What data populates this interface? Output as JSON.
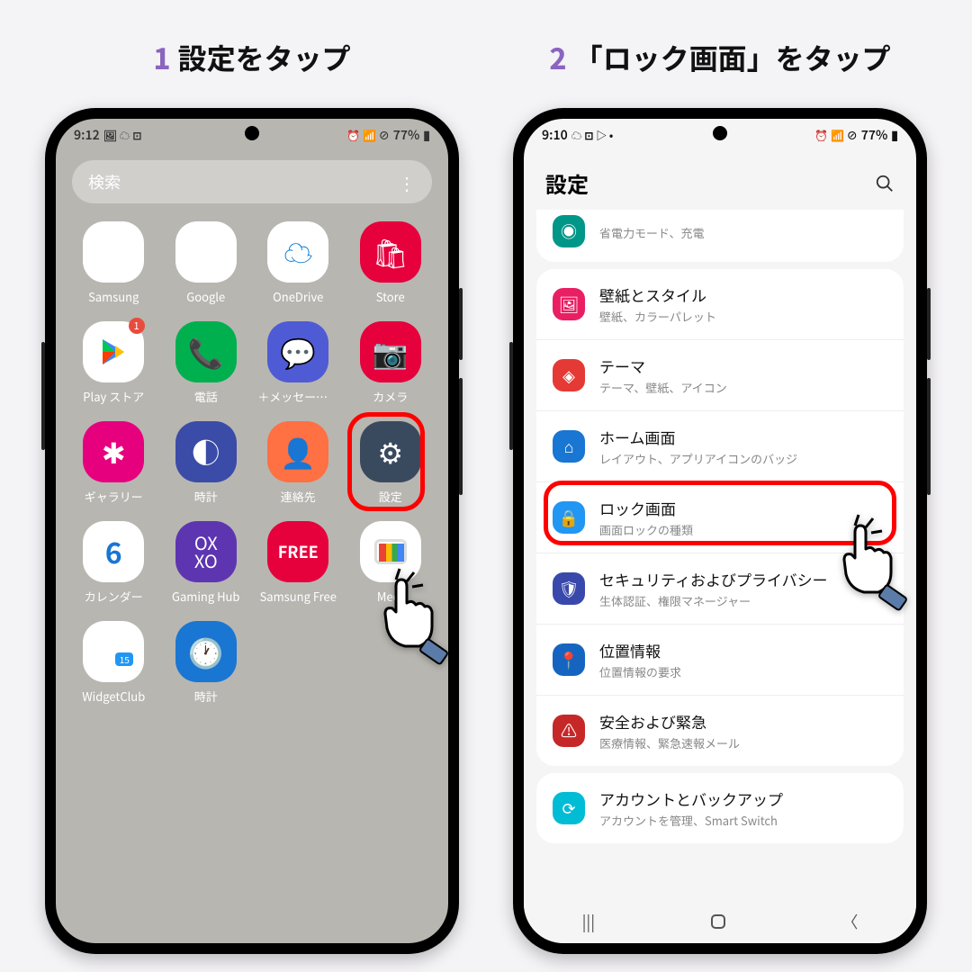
{
  "step1": {
    "num": "1",
    "text": "設定をタップ"
  },
  "step2": {
    "num": "2",
    "text": "「ロック画面」をタップ"
  },
  "status1": {
    "time": "9:12",
    "battery": "77%"
  },
  "status2": {
    "time": "9:10",
    "battery": "77%"
  },
  "search_placeholder": "検索",
  "apps": {
    "samsung": "Samsung",
    "google": "Google",
    "onedrive": "OneDrive",
    "store": "Store",
    "play": "Play ストア",
    "phone": "電話",
    "msg": "＋メッセージ(...",
    "camera": "カメラ",
    "gallery": "ギャラリー",
    "clock": "時計",
    "contacts": "連絡先",
    "settings": "設定",
    "calendar": "カレンダー",
    "gaming": "Gaming Hub",
    "free": "Samsung Free",
    "meet": "Meet",
    "widget": "WidgetClub",
    "clock2": "時計"
  },
  "play_badge": "1",
  "cal_num": "6",
  "free_label": "FREE",
  "gaming_label": "OX\nXO",
  "settings_title": "設定",
  "items": {
    "battery_sub": "省電力モード、充電",
    "wallpaper": "壁紙とスタイル",
    "wallpaper_sub": "壁紙、カラーパレット",
    "theme": "テーマ",
    "theme_sub": "テーマ、壁紙、アイコン",
    "home": "ホーム画面",
    "home_sub": "レイアウト、アプリアイコンのバッジ",
    "lock": "ロック画面",
    "lock_sub": "画面ロックの種類",
    "security": "セキュリティおよびプライバシー",
    "security_sub": "生体認証、権限マネージャー",
    "location": "位置情報",
    "location_sub": "位置情報の要求",
    "safety": "安全および緊急",
    "safety_sub": "医療情報、緊急速報メール",
    "account": "アカウントとバックアップ",
    "account_sub": "アカウントを管理、Smart Switch"
  }
}
